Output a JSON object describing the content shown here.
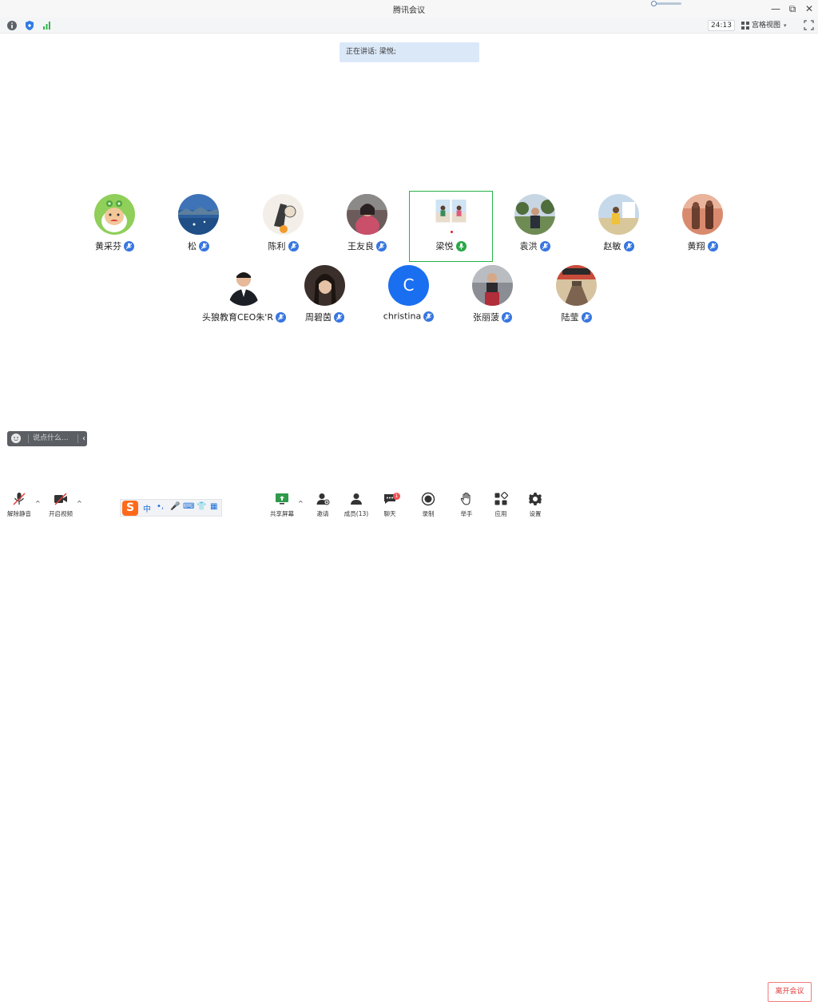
{
  "window": {
    "title": "腾讯会议",
    "minimize": "—",
    "restore": "⧉",
    "close": "✕"
  },
  "topbar": {
    "timer": "24:13",
    "view_label": "宫格视图",
    "view_caret": "▾"
  },
  "speaking": {
    "text": "正在讲话: 梁悦;"
  },
  "participants": [
    {
      "name": "黄采芬",
      "avatar": "frog-illustration"
    },
    {
      "name": "松",
      "avatar": "sea-landscape"
    },
    {
      "name": "陈利",
      "avatar": "cartoon-illustration"
    },
    {
      "name": "王友良",
      "avatar": "person-photo"
    },
    {
      "name": "梁悦",
      "avatar": "beach-photo",
      "active": true
    },
    {
      "name": "袁洪",
      "avatar": "outdoor-photo"
    },
    {
      "name": "赵敏",
      "avatar": "outdoor-photo"
    },
    {
      "name": "黄翔",
      "avatar": "statues-photo"
    },
    {
      "name": "头狼教育CEO朱'R",
      "avatar": "portrait-photo"
    },
    {
      "name": "周碧茵",
      "avatar": "portrait-photo"
    },
    {
      "name": "christina",
      "avatar": "letter",
      "initial": "C"
    },
    {
      "name": "张丽菠",
      "avatar": "portrait-photo"
    },
    {
      "name": "陆莹",
      "avatar": "poster-art"
    }
  ],
  "chat": {
    "placeholder": "说点什么...",
    "collapse": "‹"
  },
  "ime": {
    "logo": "S",
    "items": [
      "中",
      "•,",
      "🎤",
      "⌨",
      "👕",
      "▦"
    ]
  },
  "toolbar": {
    "unmute": "解除静音",
    "start_video": "开启视频",
    "share_screen": "共享屏幕",
    "invite": "邀请",
    "members": "成员(13)",
    "chat": "聊天",
    "chat_badge": "1",
    "record": "录制",
    "raise_hand": "举手",
    "apps": "应用",
    "settings": "设置",
    "leave": "离开会议",
    "caret": "^"
  },
  "colors": {
    "accent": "#3776e0",
    "active_border": "#27b24a",
    "leave": "#e23b3b",
    "speaking_bg": "#dbe8f8"
  }
}
